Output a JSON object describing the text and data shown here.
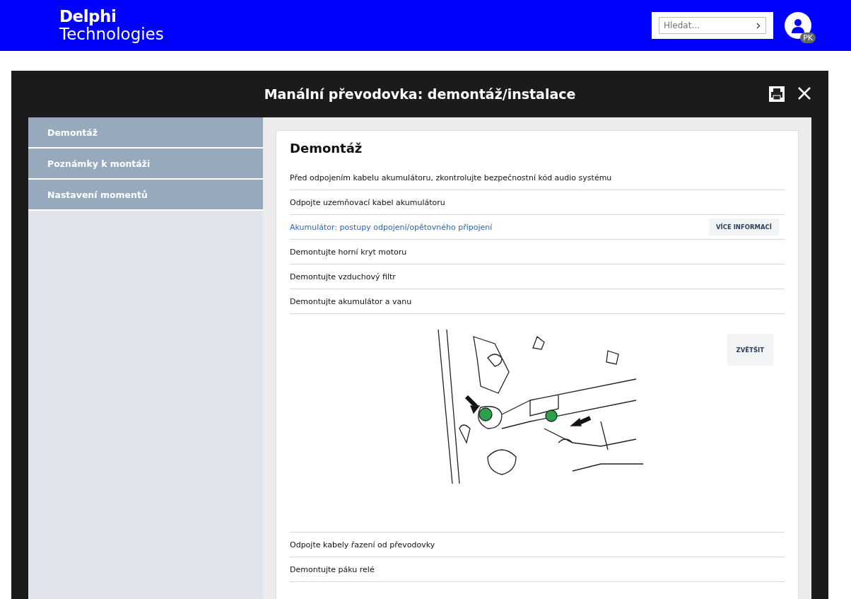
{
  "header": {
    "logo": {
      "line1": "Delphi",
      "line2": "Technologies"
    },
    "search": {
      "placeholder": "Hledat..."
    },
    "user": {
      "initials": "PK"
    }
  },
  "dialog": {
    "title": "Manální převodovka: demontáž/instalace",
    "sidebar": {
      "items": [
        {
          "label": "Demontáž"
        },
        {
          "label": "Poznámky k montáži"
        },
        {
          "label": "Nastavení momentů"
        }
      ]
    },
    "content": {
      "heading": "Demontáž",
      "steps": [
        {
          "kind": "text",
          "text": "Před odpojením kabelu akumulátoru, zkontrolujte bezpečnostní kód audio systému"
        },
        {
          "kind": "text",
          "text": "Odpojte uzemňovací kabel akumulátoru"
        },
        {
          "kind": "link",
          "text": "Akumulátor: postupy odpojení/opětovného připojení",
          "button": "VÍCE INFORMACÍ"
        },
        {
          "kind": "text",
          "text": "Demontujte horní kryt motoru"
        },
        {
          "kind": "text",
          "text": "Demontujte vzduchový filtr"
        },
        {
          "kind": "text",
          "text": "Demontujte akumulátor a vanu"
        },
        {
          "kind": "image",
          "button": "ZVĚTŠIT"
        },
        {
          "kind": "text",
          "text": "Odpojte kabely řazení od převodovky"
        },
        {
          "kind": "text",
          "text": "Demontujte páku relé"
        }
      ]
    }
  }
}
